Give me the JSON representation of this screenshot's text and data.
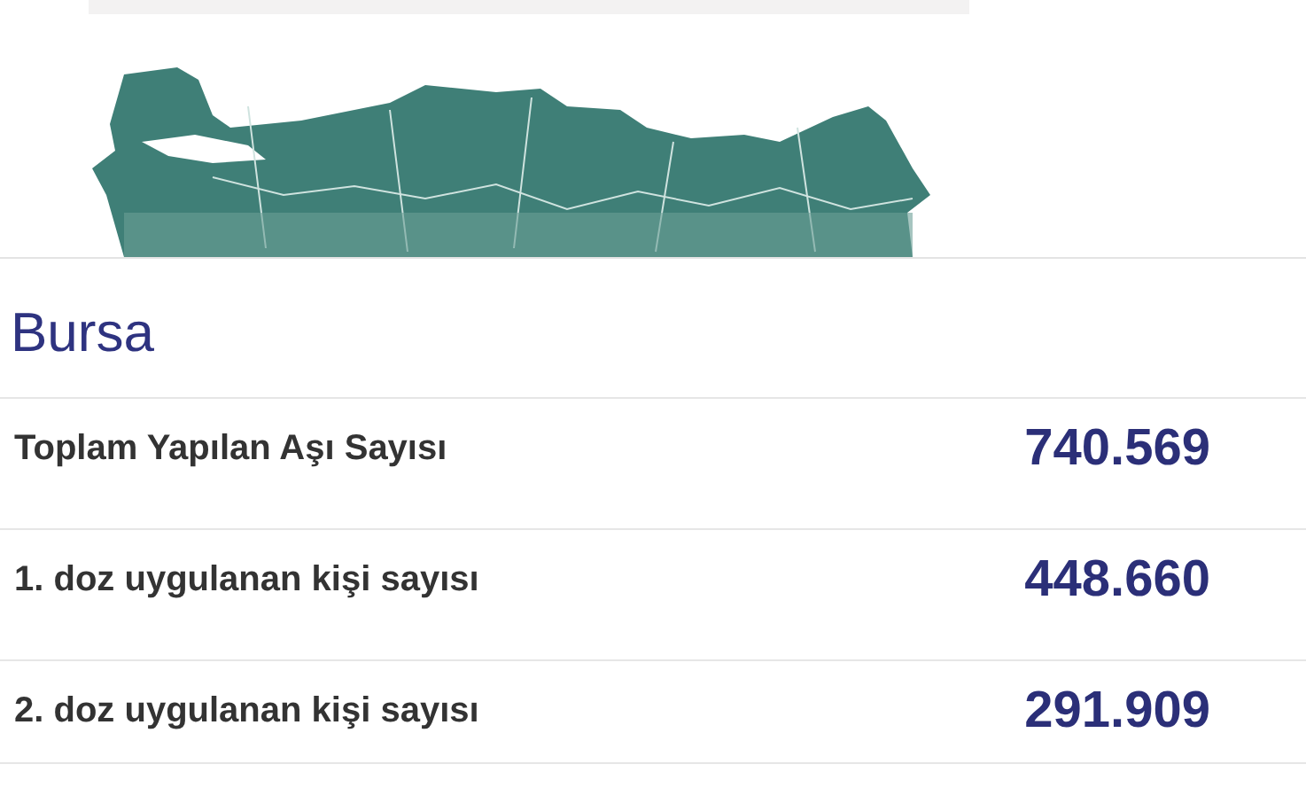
{
  "province": {
    "name": "Bursa"
  },
  "stats": [
    {
      "label": "Toplam Yapılan Aşı Sayısı",
      "value": "740.569"
    },
    {
      "label": "1. doz uygulanan kişi sayısı",
      "value": "448.660"
    },
    {
      "label": "2. doz uygulanan kişi sayısı",
      "value": "291.909"
    }
  ]
}
